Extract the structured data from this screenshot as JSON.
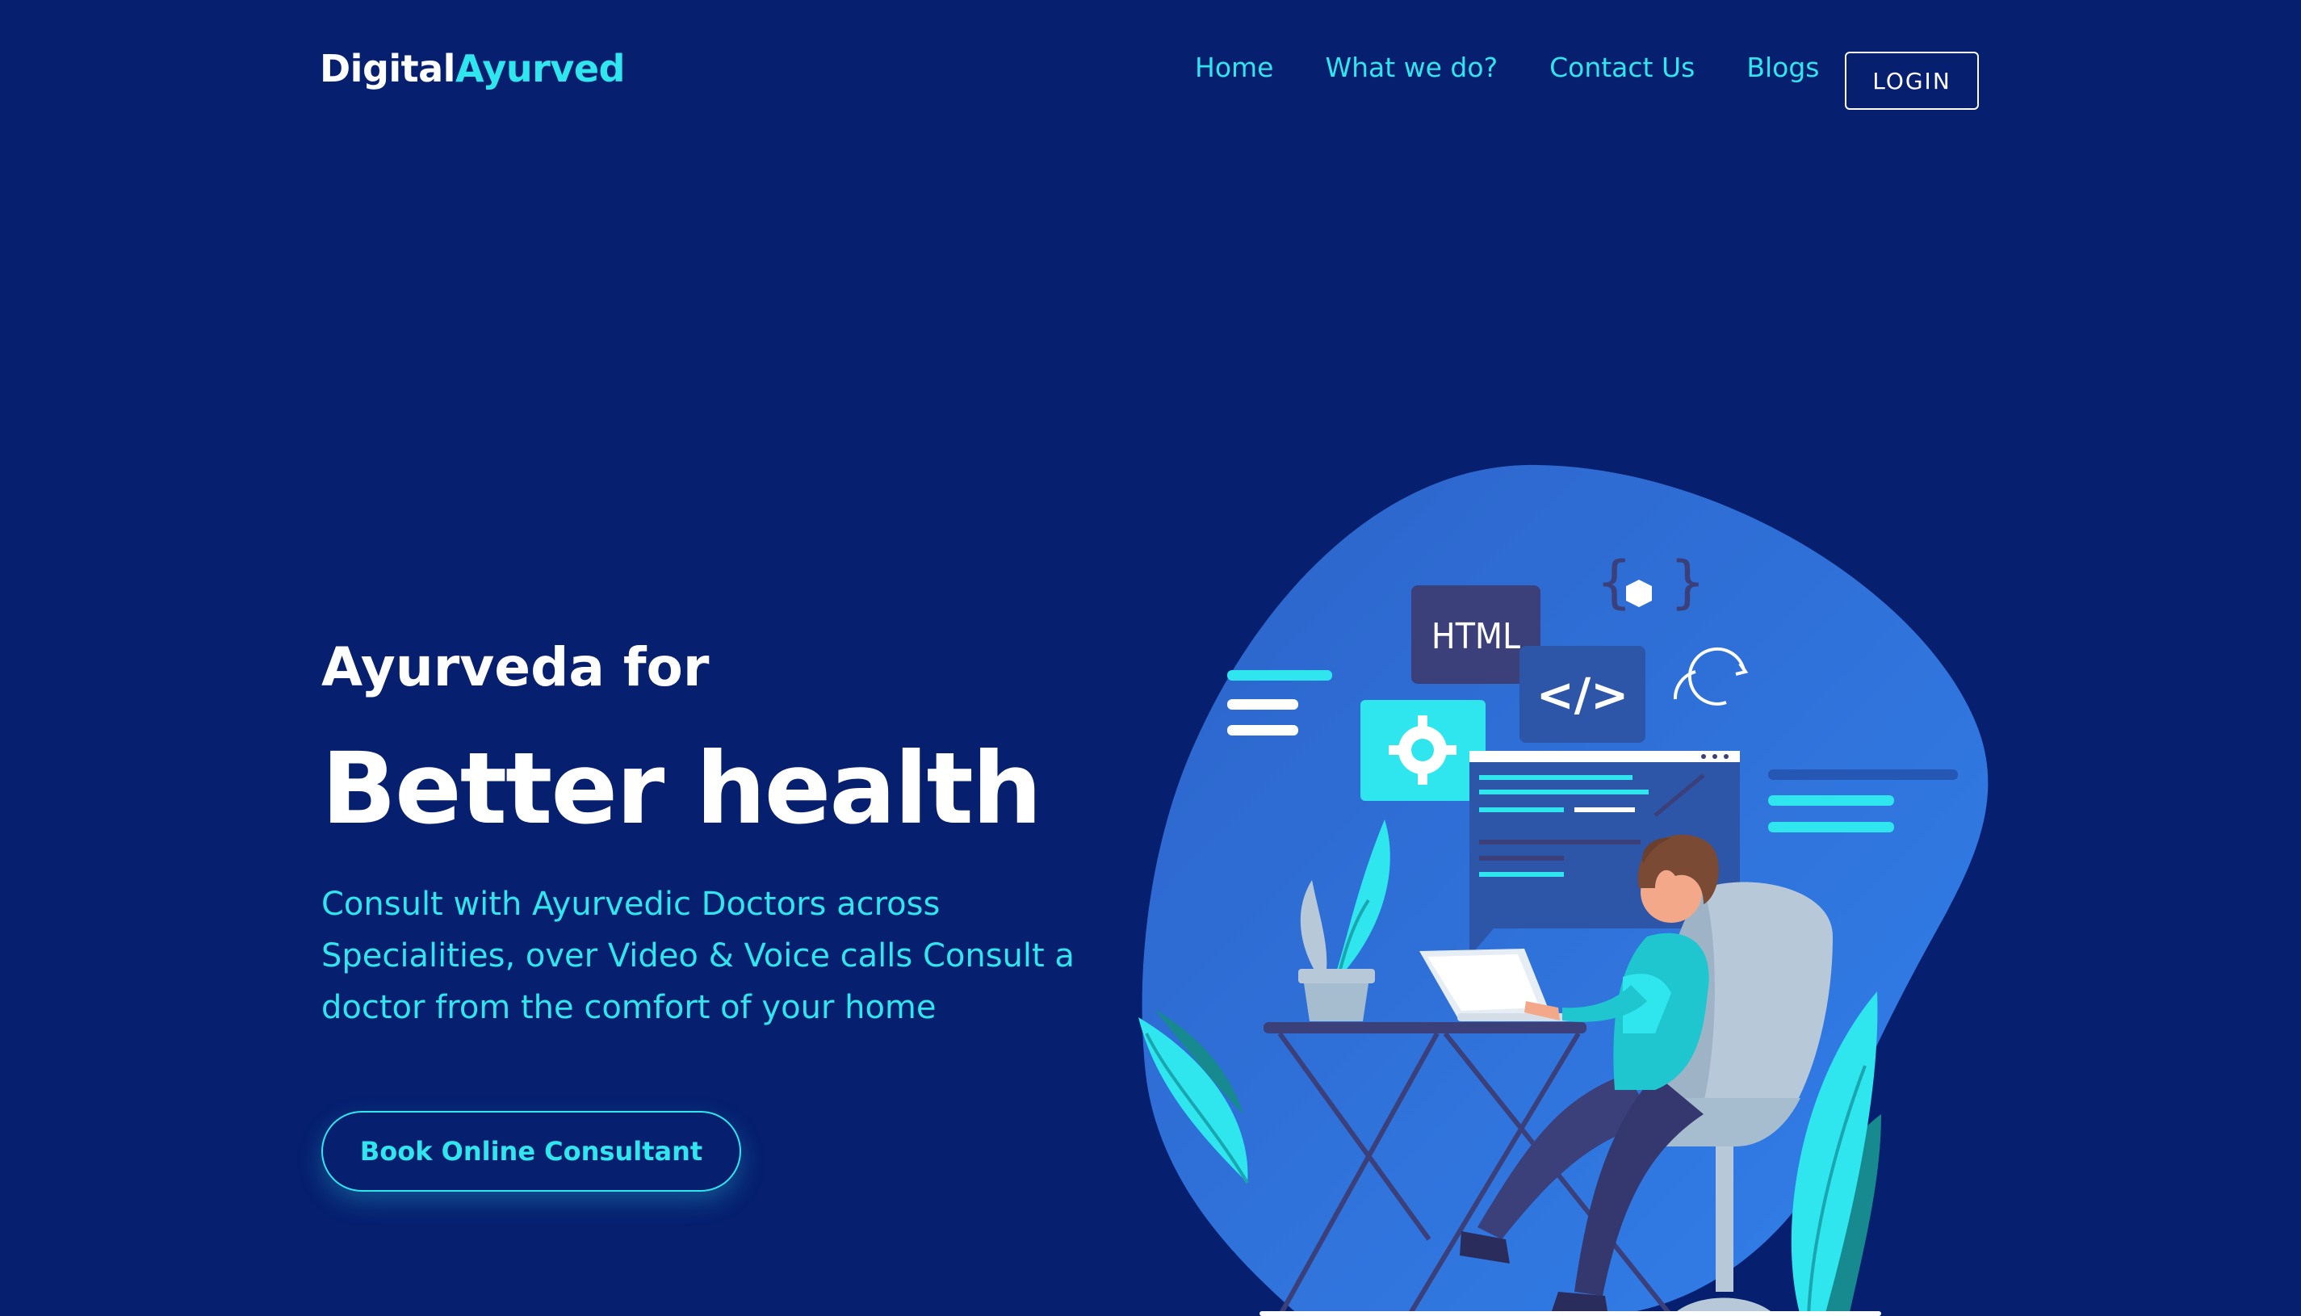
{
  "brand": {
    "part1": "Digital",
    "part2": "Ayurved"
  },
  "nav": {
    "items": [
      {
        "label": "Home"
      },
      {
        "label": "What we do?"
      },
      {
        "label": "Contact Us"
      },
      {
        "label": "Blogs"
      }
    ],
    "login_label": "LOGIN"
  },
  "hero": {
    "subtitle": "Ayurveda for",
    "title": "Better health",
    "description": "Consult with Ayurvedic Doctors across Specialities, over Video & Voice calls Consult a doctor from the comfort of your home",
    "cta_label": "Book Online Consultant"
  },
  "illustration": {
    "html_tag": "HTML",
    "code_tag": "</>",
    "icons": [
      "gear-icon",
      "code-icon",
      "refresh-icon",
      "cube-icon"
    ]
  },
  "colors": {
    "background": "#061f6f",
    "accent": "#2fe6ee",
    "blob": "#2f74dc",
    "text": "#ffffff"
  }
}
